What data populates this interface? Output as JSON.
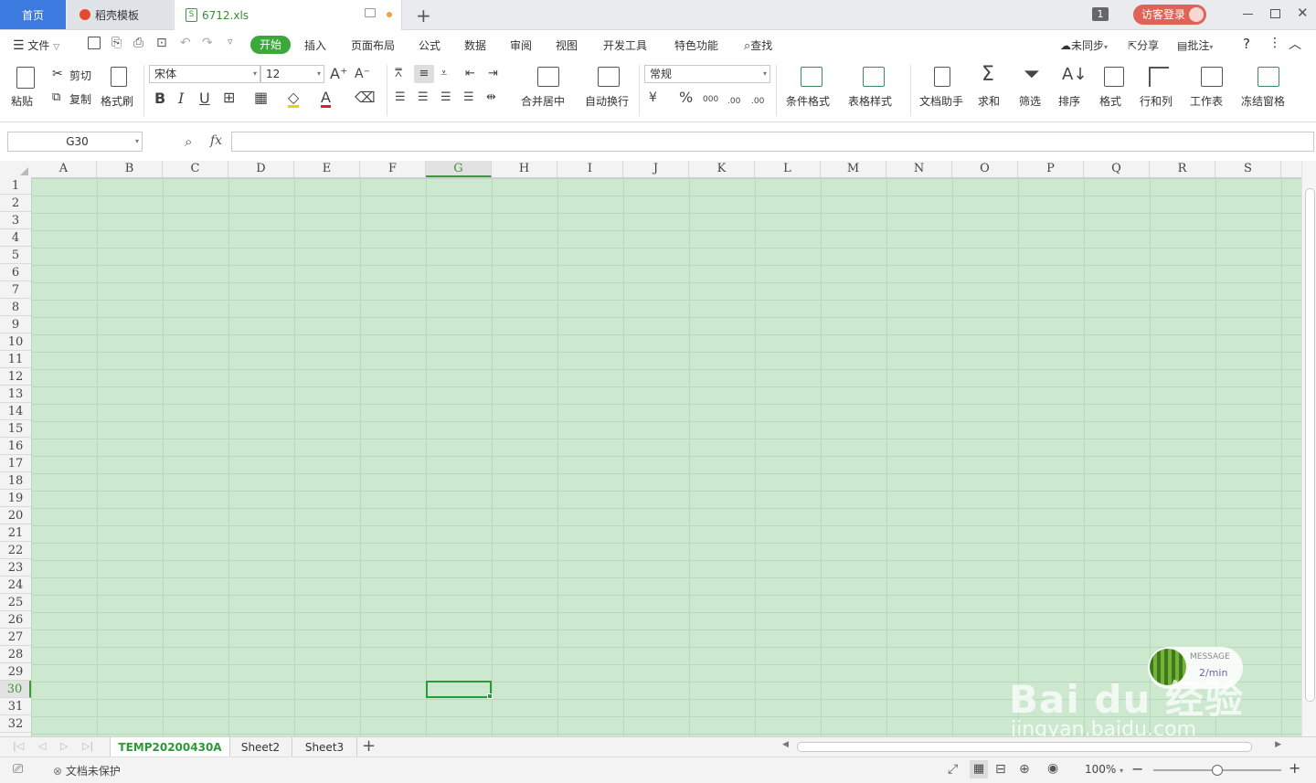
{
  "tabs": {
    "home": "首页",
    "docer": "稻壳模板",
    "file": "6712.xls"
  },
  "titlebar": {
    "window_count": "1",
    "login_label": "访客登录"
  },
  "menu": {
    "file": "文件",
    "start": "开始",
    "insert": "插入",
    "page_layout": "页面布局",
    "formula": "公式",
    "data": "数据",
    "review": "审阅",
    "view": "视图",
    "dev_tools": "开发工具",
    "special": "特色功能",
    "search": "查找",
    "unsync": "未同步",
    "share": "分享",
    "comment": "批注",
    "help": "?"
  },
  "ribbon": {
    "paste": "粘贴",
    "cut": "剪切",
    "copy": "复制",
    "format_painter": "格式刷",
    "font_name": "宋体",
    "font_size": "12",
    "merge_center": "合并居中",
    "wrap_text": "自动换行",
    "number_format": "常规",
    "cond_format": "条件格式",
    "table_style": "表格样式",
    "doc_assistant": "文档助手",
    "sum": "求和",
    "filter": "筛选",
    "sort": "排序",
    "format": "格式",
    "row_col": "行和列",
    "worksheet": "工作表",
    "freeze": "冻结窗格",
    "bold": "B",
    "italic": "I",
    "underline": "U",
    "font_color": "A",
    "percent": "%",
    "thousands": "000",
    "dec_inc": ".00",
    "dec_dec": ".00"
  },
  "formula_bar": {
    "name_box": "G30",
    "fx": "fx",
    "value": ""
  },
  "grid": {
    "columns": [
      "A",
      "B",
      "C",
      "D",
      "E",
      "F",
      "G",
      "H",
      "I",
      "J",
      "K",
      "L",
      "M",
      "N",
      "O",
      "P",
      "Q",
      "R",
      "S"
    ],
    "rows": [
      "1",
      "2",
      "3",
      "4",
      "5",
      "6",
      "7",
      "8",
      "9",
      "10",
      "11",
      "12",
      "13",
      "14",
      "15",
      "16",
      "17",
      "18",
      "19",
      "20",
      "21",
      "22",
      "23",
      "24",
      "25",
      "26",
      "27",
      "28",
      "29",
      "30",
      "31",
      "32"
    ],
    "active_col": "G",
    "active_row": "30",
    "cell_bg": "#cce8cf",
    "accent": "#3a9a3a"
  },
  "sheets": [
    "TEMP20200430A",
    "Sheet2",
    "Sheet3"
  ],
  "status": {
    "protect": "文档未保护",
    "zoom": "100%"
  },
  "watermark": {
    "message": "MESSAGE",
    "rate": "2/min",
    "brand": "Bai du 经验",
    "url": "jingyan.baidu.com"
  }
}
